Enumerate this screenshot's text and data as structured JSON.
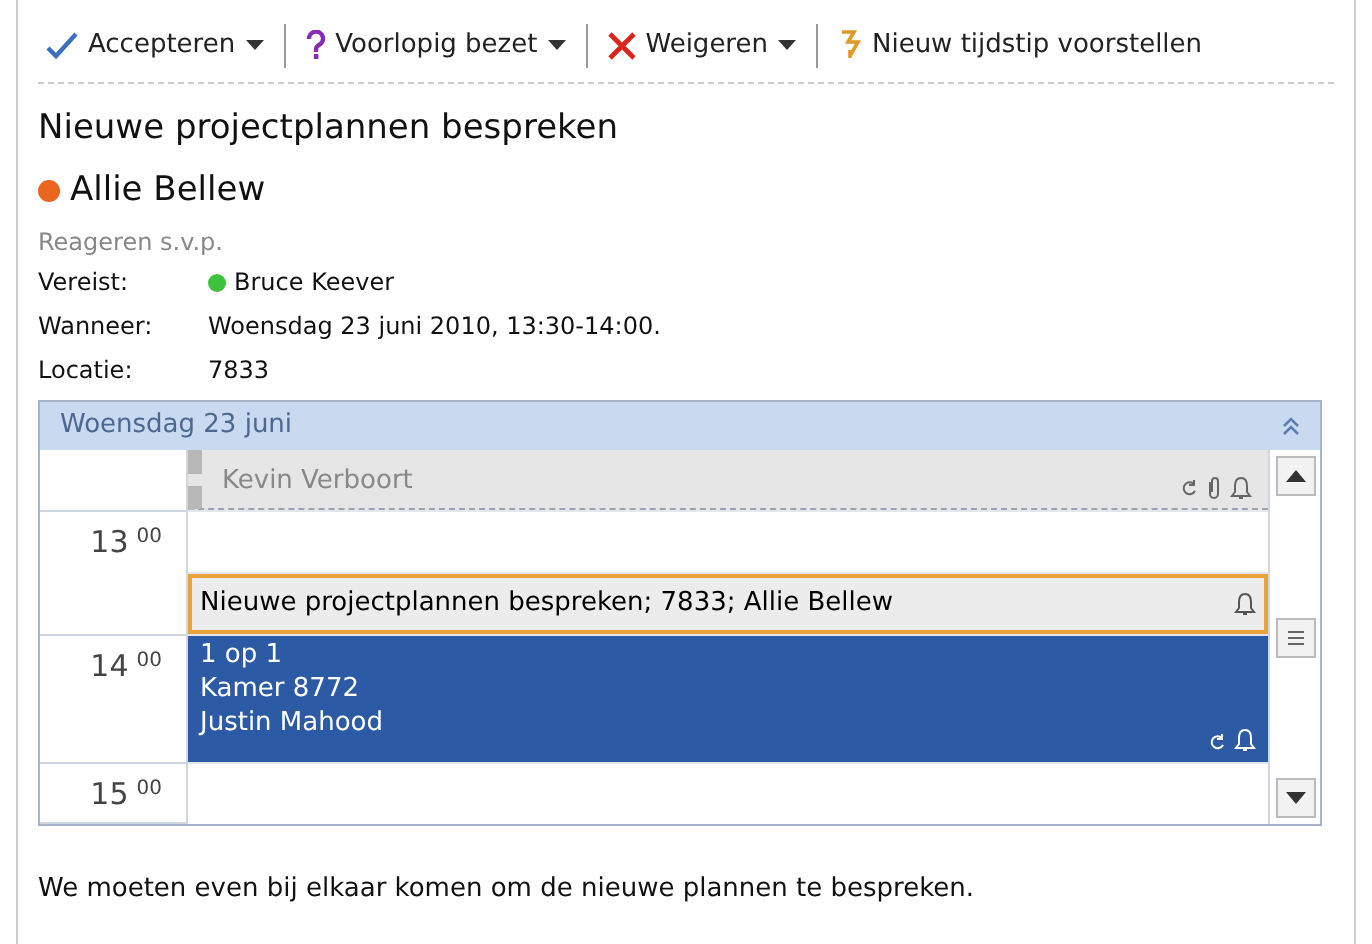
{
  "toolbar": [
    {
      "kind": "accept",
      "label": "Accepteren",
      "dropdown": true
    },
    {
      "kind": "tentative",
      "label": "Voorlopig bezet",
      "dropdown": true
    },
    {
      "kind": "decline",
      "label": "Weigeren",
      "dropdown": true
    },
    {
      "kind": "propose",
      "label": "Nieuw tijdstip voorstellen",
      "dropdown": false
    }
  ],
  "subject": "Nieuwe projectplannen bespreken",
  "organizer": {
    "name": "Allie Bellew",
    "color": "#e8661e"
  },
  "response_note": "Reageren s.v.p.",
  "details": [
    {
      "label": "Vereist:",
      "value": "Bruce Keever",
      "color": "#3cc23c"
    },
    {
      "label": "Wanneer:",
      "value": "Woensdag 23 juni 2010, 13:30-14:00."
    },
    {
      "label": "Locatie:",
      "value": "7833"
    }
  ],
  "calendar": {
    "day": "Woensdag 23 juni",
    "hours": [
      {
        "hour": "13",
        "minutes": "00"
      },
      {
        "hour": "14",
        "minutes": "00"
      },
      {
        "hour": "15",
        "minutes": "00"
      }
    ],
    "events": [
      {
        "kind": "tentative",
        "lines": [
          "Kevin Verboort"
        ]
      },
      {
        "kind": "current",
        "lines": [
          "Nieuwe projectplannen bespreken; 7833; Allie Bellew"
        ]
      },
      {
        "kind": "busy",
        "lines": [
          "1 op 1",
          "Kamer 8772",
          "Justin Mahood"
        ]
      }
    ]
  },
  "body": "We moeten even bij elkaar komen om de nieuwe plannen te bespreken."
}
